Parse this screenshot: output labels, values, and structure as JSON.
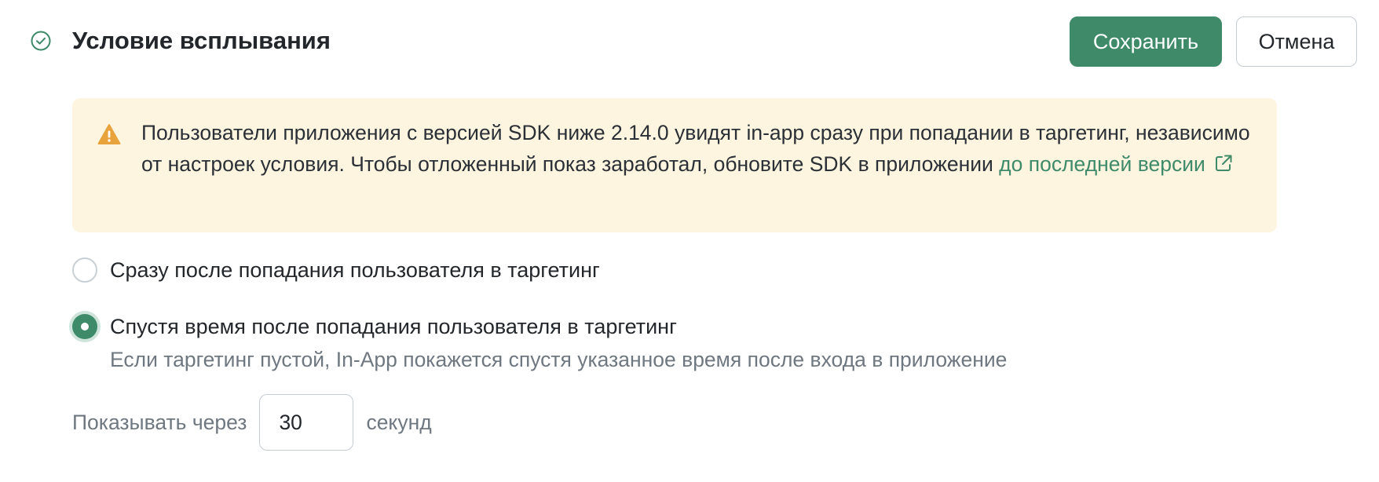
{
  "header": {
    "status_icon": "check-circle-icon",
    "title": "Условие всплывания",
    "save_label": "Сохранить",
    "cancel_label": "Отмена"
  },
  "alert": {
    "icon": "warning-triangle-icon",
    "text_before_link": "Пользователи приложения с версией SDK ниже 2.14.0 увидят in-app сразу при попадании в таргетинг, независимо от настроек условия. Чтобы отложенный показ заработал, обновите SDK в приложении ",
    "link_text": "до последней версии",
    "link_icon": "external-link-icon"
  },
  "options": [
    {
      "label": "Сразу после попадания пользователя в таргетинг",
      "selected": false
    },
    {
      "label": "Спустя время после попадания пользователя в таргетинг",
      "hint": "Если таргетинг пустой, In-App покажется спустя указанное время после входа в приложение",
      "selected": true
    }
  ],
  "delay": {
    "prefix": "Показывать через",
    "value": "30",
    "suffix": "секунд"
  },
  "colors": {
    "accent": "#3e8a69",
    "alert_bg": "#fdf5df",
    "warning": "#e8a33c"
  }
}
